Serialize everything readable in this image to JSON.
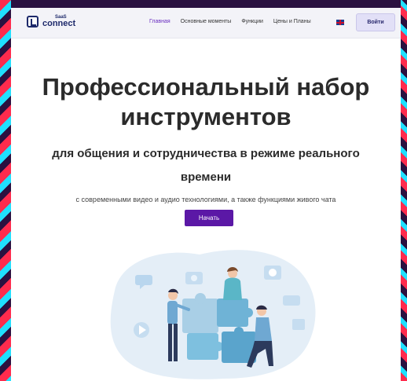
{
  "header": {
    "logo": {
      "saas": "SaaS",
      "name": "connect"
    },
    "nav": [
      "Главная",
      "Основные моменты",
      "Функции",
      "Цены и Планы"
    ],
    "active_nav": "Главная",
    "language_icon": "uk-flag-icon",
    "login_label": "Войти"
  },
  "hero": {
    "title": "Профессиональный набор инструментов",
    "subtitle": "для общения и сотрудничества в режиме реального времени",
    "description": "с современными видео и аудио технологиями, а также функциями живого чата",
    "cta_label": "Начать"
  },
  "colors": {
    "accent": "#5b18a6",
    "brand": "#1e2a6b",
    "frame_background": "#2a1140",
    "puzzle": "#8fc2e0",
    "blob": "#e4eef7"
  },
  "icons": [
    "logo-icon",
    "uk-flag-icon",
    "play-icon",
    "camera-icon",
    "chat-icon",
    "microphone-icon",
    "speaker-icon"
  ]
}
